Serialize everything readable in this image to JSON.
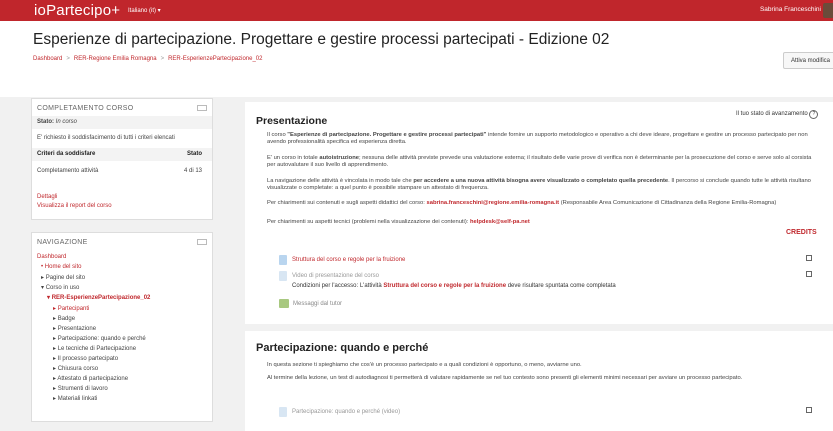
{
  "topbar": {
    "brand": "ioPartecipo+",
    "language": "Italiano (it) ▾",
    "user": "Sabrina Franceschini"
  },
  "page": {
    "title": "Esperienze di partecipazione. Progettare e gestire processi partecipati - Edizione 02",
    "breadcrumb": [
      "Dashboard",
      "RER-Regione Emilia Romagna",
      "RER-EsperienzePartecipazione_02"
    ],
    "edit_button": "Attiva modifica"
  },
  "completion": {
    "header": "COMPLETAMENTO CORSO",
    "status_label": "Stato:",
    "status_value": "In corso",
    "requirement": "E' richiesto il soddisfacimento di tutti i criteri elencati",
    "col_criteria": "Criteri da soddisfare",
    "col_status": "Stato",
    "row_label": "Completamento attività",
    "row_value": "4 di 13",
    "link_details": "Dettagli",
    "link_report": "Visualizza il report del corso"
  },
  "navigation": {
    "header": "NAVIGAZIONE",
    "items": [
      "Dashboard",
      "Home del sito",
      "Pagine del sito",
      "Corso in uso",
      "RER-EsperienzePartecipazione_02",
      "Partecipanti",
      "Badge",
      "Presentazione",
      "Partecipazione: quando e perché",
      "Le tecniche di Partecipazione",
      "Il processo partecipato",
      "Chiusura corso",
      "Attestato di partecipazione",
      "Strumenti di lavoro",
      "Materiali linkati"
    ]
  },
  "progress_label": "Il tuo stato di avanzamento",
  "presentazione": {
    "title": "Presentazione",
    "p1a": "Il corso ",
    "p1b": "\"Esperienze di partecipazione. Progettare e gestire processi partecipati\"",
    "p1c": " intende fornire un supporto metodologico e operativo a chi deve ideare, progettare e gestire un processo partecipato per non avendo professionalità specifica ed esperienza diretta.",
    "p2a": "E' un corso in totale ",
    "p2b": "autoistruzione",
    "p2c": "; nessuna delle attività previste prevede una valutazione esterna; il risultato delle varie prove di verifica non è determinante per la prosecuzione del corso e serve solo al corsista per autovalutare il suo livello di apprendimento.",
    "p3a": "La navigazione delle attività è vincolata in modo tale che ",
    "p3b": "per accedere a una nuova attività bisogna avere visualizzato o completato quella precedente",
    "p3c": ". Il percorso si conclude quando tutte le attività risultano visualizzate o completate: a quel punto è possibile stampare un attestato di frequenza.",
    "p4a": "Per chiarimenti sui contenuti e sugli aspetti didattici del corso: ",
    "p4b": "sabrina.franceschini@regione.emilia-romagna.it",
    "p4c": " (Responsabile Area Comunicazione di Cittadinanza della Regione Emilia-Romagna)",
    "p5a": "Per chiarimenti su aspetti tecnici (problemi nella visualizzazione dei contenuti): ",
    "p5b": "helpdesk@self-pa.net",
    "credits": "CREDITS",
    "act1": "Struttura del corso e regole per la fruizione",
    "act2": "Video di presentazione del corso",
    "cond_a": "Condizioni per l'accesso: L'attività ",
    "cond_b": "Struttura del corso e regole per la fruizione",
    "cond_c": " deve risultare spuntata come completata",
    "act3": "Messaggi dal tutor"
  },
  "partecipazione": {
    "title": "Partecipazione: quando e perché",
    "p1": "In questa sezione ti spieghiamo che cos'è un processo partecipato e a quali condizioni è opportuno, o meno, avviarne uno.",
    "p2": "Al termine della lezione, un test di autodiagnosi ti permetterà di valutare rapidamente se nel tuo contesto sono presenti gli elementi minimi necessari per avviare un processo partecipato.",
    "act1": "Partecipazione: quando e perché (video)"
  },
  "colors": {
    "brand_red": "#c0262c",
    "link_red": "#c0282d"
  },
  "icons": [
    "settings-icon",
    "help-icon",
    "page-icon",
    "chat-icon",
    "checkbox-icon"
  ]
}
